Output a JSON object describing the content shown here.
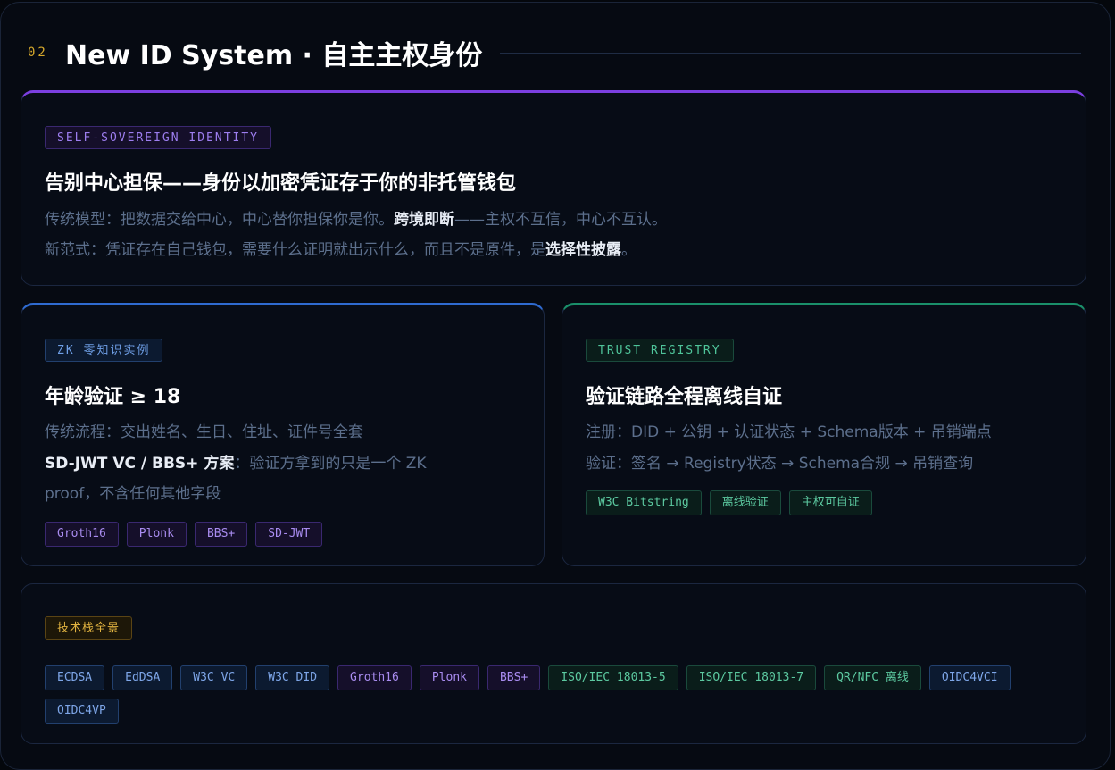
{
  "section": {
    "number": "02",
    "title": "New ID System · 自主主权身份"
  },
  "ssi_card": {
    "eyebrow": "SELF-SOVEREIGN IDENTITY",
    "title": "告别中心担保——身份以加密凭证存于你的非托管钱包",
    "line1_pre": "传统模型：把数据交给中心，中心替你担保你是你。",
    "line1_bold": "跨境即断",
    "line1_post": "——主权不互信，中心不互认。",
    "line2_pre": "新范式：凭证存在自己钱包，需要什么证明就出示什么，而且不是原件，是",
    "line2_bold": "选择性披露",
    "line2_post": "。"
  },
  "zk_card": {
    "eyebrow": "ZK 零知识实例",
    "title": "年龄验证 ≥ 18",
    "line1": "传统流程：交出姓名、生日、住址、证件号全套",
    "line2_bold": "SD-JWT VC / BBS+ 方案",
    "line2_post": "：验证方拿到的只是一个 ZK",
    "line3": "proof，不含任何其他字段",
    "tags": [
      "Groth16",
      "Plonk",
      "BBS+",
      "SD-JWT"
    ]
  },
  "trust_card": {
    "eyebrow": "TRUST REGISTRY",
    "title": "验证链路全程离线自证",
    "line1": "注册：DID + 公钥 + 认证状态 + Schema版本 + 吊销端点",
    "line2": "验证：签名 → Registry状态 → Schema合规 → 吊销查询",
    "tags": [
      "W3C Bitstring",
      "离线验证",
      "主权可自证"
    ]
  },
  "stack_card": {
    "eyebrow": "技术栈全景",
    "tags": [
      {
        "label": "ECDSA",
        "color": "blue"
      },
      {
        "label": "EdDSA",
        "color": "blue"
      },
      {
        "label": "W3C VC",
        "color": "blue"
      },
      {
        "label": "W3C DID",
        "color": "blue"
      },
      {
        "label": "Groth16",
        "color": "purple"
      },
      {
        "label": "Plonk",
        "color": "purple"
      },
      {
        "label": "BBS+",
        "color": "purple"
      },
      {
        "label": "ISO/IEC 18013-5",
        "color": "green"
      },
      {
        "label": "ISO/IEC 18013-7",
        "color": "green"
      },
      {
        "label": "QR/NFC 离线",
        "color": "green"
      },
      {
        "label": "OIDC4VCI",
        "color": "blue"
      },
      {
        "label": "OIDC4VP",
        "color": "blue"
      }
    ]
  }
}
